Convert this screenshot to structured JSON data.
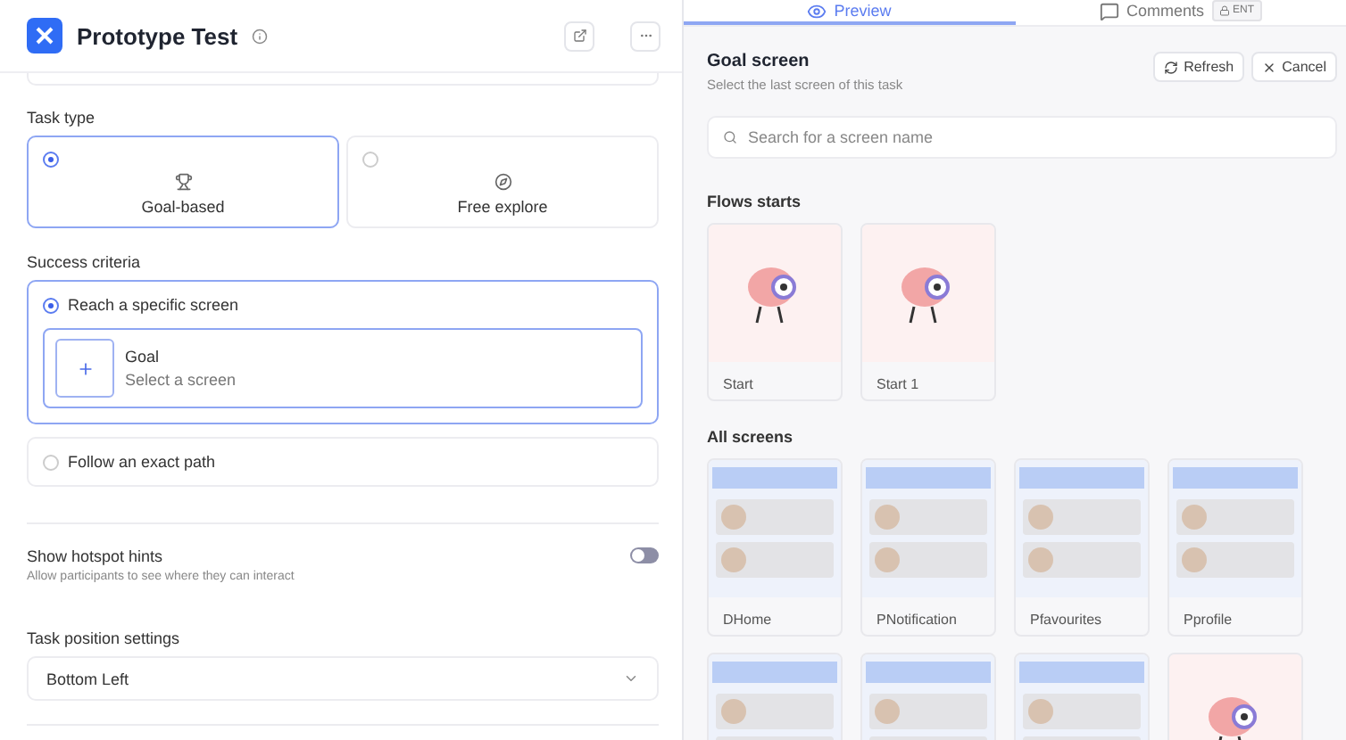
{
  "header": {
    "title": "Prototype Test"
  },
  "task_type": {
    "label": "Task type",
    "options": [
      {
        "label": "Goal-based",
        "kind": "goal",
        "selected": true
      },
      {
        "label": "Free explore",
        "kind": "explore",
        "selected": false
      }
    ]
  },
  "success_criteria": {
    "label": "Success criteria",
    "options": [
      {
        "label": "Reach a specific screen",
        "selected": true,
        "goal": {
          "title": "Goal",
          "subtitle": "Select a screen"
        }
      },
      {
        "label": "Follow an exact path",
        "selected": false
      }
    ]
  },
  "hotspot_hints": {
    "label": "Show hotspot hints",
    "description": "Allow participants to see where they can interact",
    "on": false
  },
  "task_position": {
    "label": "Task position settings",
    "value": "Bottom Left"
  },
  "tabs": [
    {
      "label": "Preview",
      "kind": "preview",
      "selected": true
    },
    {
      "label": "Comments",
      "kind": "comments",
      "selected": false,
      "badge": "ENT"
    }
  ],
  "goal_screen": {
    "title": "Goal screen",
    "subtitle": "Select the last screen of this task",
    "buttons": [
      {
        "label": "Refresh",
        "kind": "refresh"
      },
      {
        "label": "Cancel",
        "kind": "cancel"
      }
    ],
    "search": {
      "placeholder": "Search for a screen name"
    }
  },
  "flows_starts": {
    "title": "Flows starts",
    "screens": [
      {
        "name": "Start",
        "kind": "illustration"
      },
      {
        "name": "Start 1",
        "kind": "illustration"
      }
    ]
  },
  "all_screens": {
    "title": "All screens",
    "screens": [
      {
        "name": "DHome",
        "kind": "mockup"
      },
      {
        "name": "PNotification",
        "kind": "mockup"
      },
      {
        "name": "Pfavourites",
        "kind": "mockup"
      },
      {
        "name": "Pprofile",
        "kind": "mockup"
      },
      {
        "kind": "mockup"
      },
      {
        "kind": "mockup"
      },
      {
        "kind": "mockup"
      },
      {
        "kind": "illustration"
      }
    ]
  }
}
